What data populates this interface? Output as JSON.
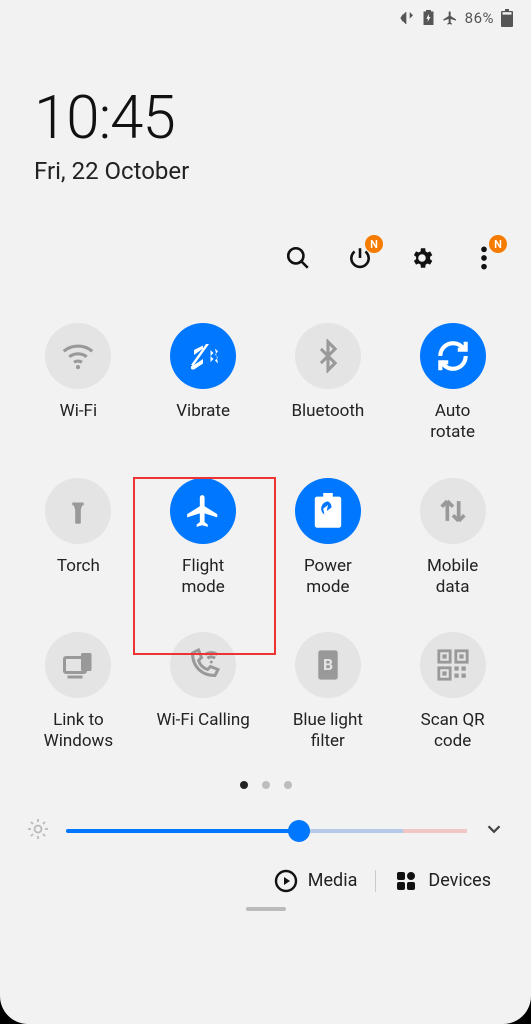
{
  "status": {
    "battery_pct": "86%",
    "badge_letter": "N"
  },
  "clock": {
    "time": "10:45",
    "date": "Fri, 22 October"
  },
  "tiles": [
    {
      "label": "Wi-Fi"
    },
    {
      "label": "Vibrate"
    },
    {
      "label": "Bluetooth"
    },
    {
      "label": "Auto\nrotate"
    },
    {
      "label": "Torch"
    },
    {
      "label": "Flight\nmode"
    },
    {
      "label": "Power\nmode"
    },
    {
      "label": "Mobile\ndata"
    },
    {
      "label": "Link to\nWindows"
    },
    {
      "label": "Wi-Fi Calling"
    },
    {
      "label": "Blue light\nfilter"
    },
    {
      "label": "Scan QR\ncode"
    }
  ],
  "brightness": {
    "percent": 58
  },
  "bottom": {
    "media": "Media",
    "devices": "Devices"
  }
}
